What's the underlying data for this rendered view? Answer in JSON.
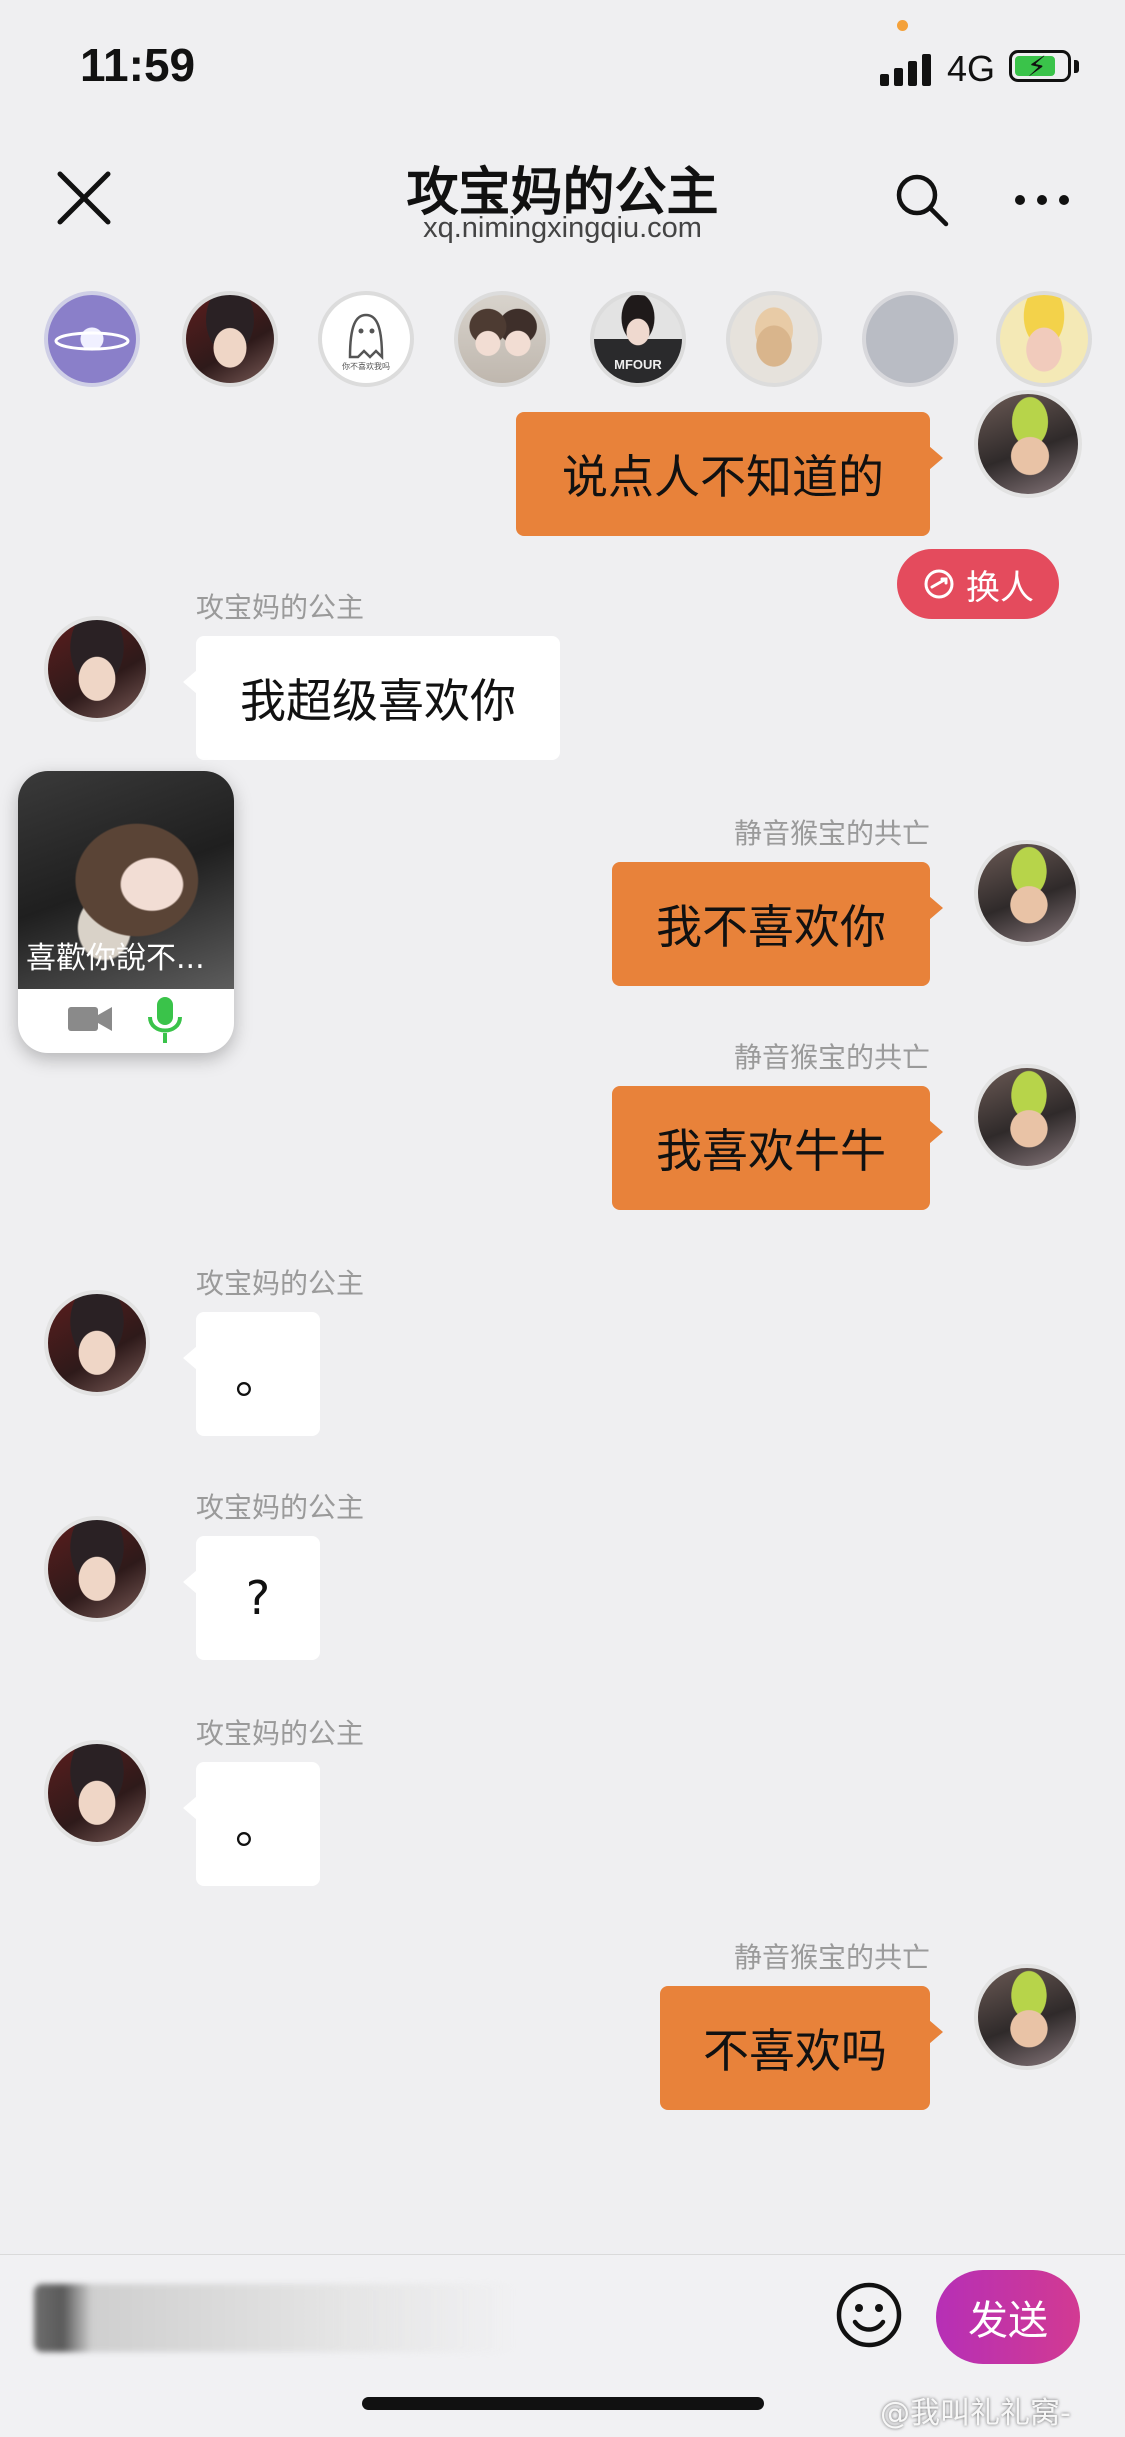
{
  "status_bar": {
    "time": "11:59",
    "network": "4G"
  },
  "header": {
    "title": "攻宝妈的公主",
    "subtitle": "xq.nimingxingqiu.com"
  },
  "colors": {
    "outgoing_bubble": "#e8823a",
    "incoming_bubble": "#ffffff",
    "swap_button": "#e44b5d",
    "send_button": "#c13aa6",
    "mic_active": "#3ac34a"
  },
  "icons": {
    "close": "close-icon",
    "search": "search-icon",
    "more": "more-icon",
    "swap": "swap-icon",
    "camera": "video-camera-icon",
    "mic": "microphone-icon",
    "emoji": "emoji-icon"
  },
  "strip_avatar_text": "你不喜欢我吗",
  "strip_avatar_mfour": "MFOUR",
  "swap_button": {
    "label": "换人"
  },
  "float_window": {
    "caption": "喜歡你說不..."
  },
  "messages": [
    {
      "side": "out",
      "sender": "",
      "text": "说点人不知道的"
    },
    {
      "side": "in",
      "sender": "攻宝妈的公主",
      "text": "我超级喜欢你"
    },
    {
      "side": "out",
      "sender": "静音猴宝的共亡",
      "text": "我不喜欢你"
    },
    {
      "side": "out",
      "sender": "静音猴宝的共亡",
      "text": "我喜欢牛牛"
    },
    {
      "side": "in",
      "sender": "攻宝妈的公主",
      "text": "。"
    },
    {
      "side": "in",
      "sender": "攻宝妈的公主",
      "text": "?"
    },
    {
      "side": "in",
      "sender": "攻宝妈的公主",
      "text": "。"
    },
    {
      "side": "out",
      "sender": "静音猴宝的共亡",
      "text": "不喜欢吗"
    }
  ],
  "composer": {
    "send_label": "发送"
  },
  "watermark": "@我叫礼礼窝-"
}
